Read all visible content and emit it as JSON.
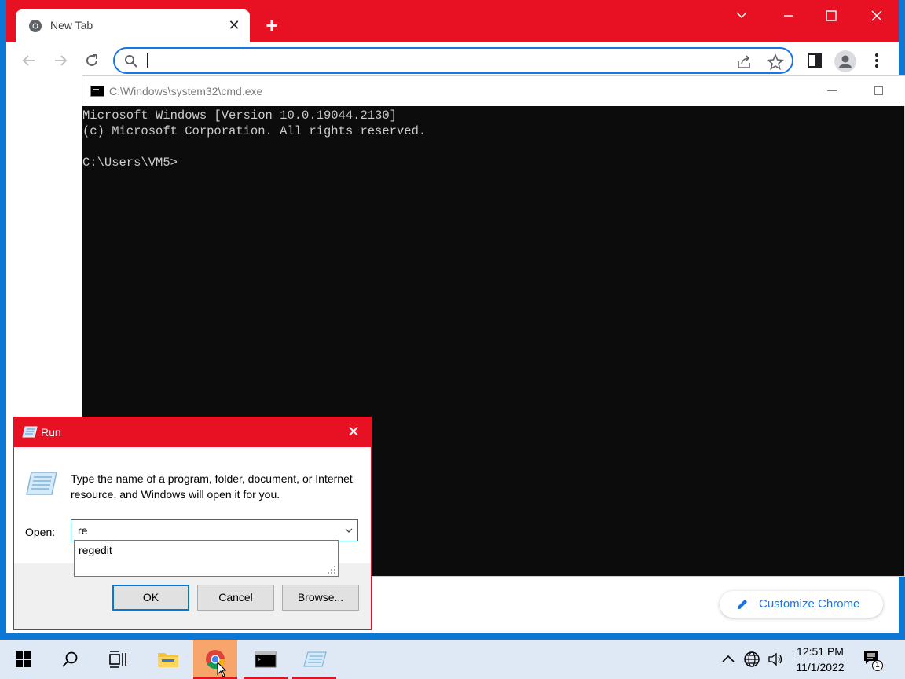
{
  "chrome": {
    "tab_title": "New Tab",
    "address_value": "",
    "customize_label": "Customize Chrome",
    "colors": {
      "accent": "#e81123",
      "link": "#1a73e8"
    }
  },
  "cmd": {
    "title": "C:\\Windows\\system32\\cmd.exe",
    "lines": [
      "Microsoft Windows [Version 10.0.19044.2130]",
      "(c) Microsoft Corporation. All rights reserved.",
      "",
      "C:\\Users\\VM5>"
    ]
  },
  "run": {
    "title": "Run",
    "description": "Type the name of a program, folder, document, or Internet resource, and Windows will open it for you.",
    "open_label": "Open:",
    "input_value": "re",
    "suggestion": "regedit",
    "ok_label": "OK",
    "cancel_label": "Cancel",
    "browse_label": "Browse..."
  },
  "taskbar": {
    "time": "12:51 PM",
    "date": "11/1/2022",
    "notification_count": "1",
    "apps": [
      "start-icon",
      "search-icon",
      "task-view-icon",
      "file-explorer-icon",
      "chrome-icon",
      "cmd-icon",
      "run-icon"
    ]
  }
}
